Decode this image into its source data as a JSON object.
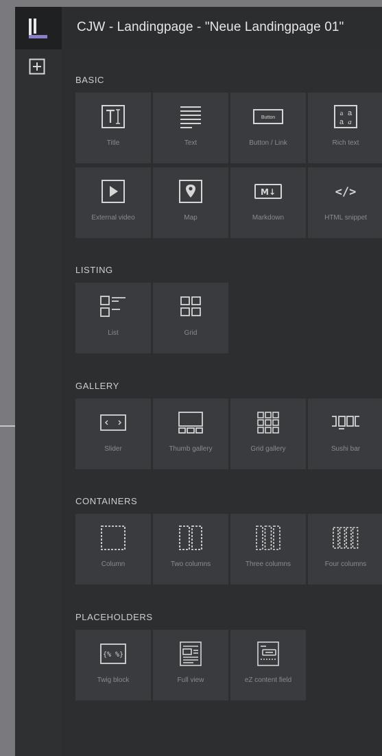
{
  "window": {
    "title": "CJW - Landingpage - \"Neue Landingpage 01\" "
  },
  "sidebar": {
    "add_icon": "plus-square-icon",
    "logo": "app-logo"
  },
  "sections": {
    "basic": {
      "label": "BASIC",
      "items": [
        {
          "label": "Title",
          "icon": "title-icon"
        },
        {
          "label": "Text",
          "icon": "text-icon"
        },
        {
          "label": "Button / Link",
          "icon": "button-icon"
        },
        {
          "label": "Rich text",
          "icon": "rich-text-icon"
        },
        {
          "label": "External video",
          "icon": "video-icon"
        },
        {
          "label": "Map",
          "icon": "map-icon"
        },
        {
          "label": "Markdown",
          "icon": "markdown-icon"
        },
        {
          "label": "HTML snippet",
          "icon": "code-icon"
        }
      ]
    },
    "listing": {
      "label": "LISTING",
      "items": [
        {
          "label": "List",
          "icon": "list-icon"
        },
        {
          "label": "Grid",
          "icon": "grid-icon"
        }
      ]
    },
    "gallery": {
      "label": "GALLERY",
      "items": [
        {
          "label": "Slider",
          "icon": "slider-icon"
        },
        {
          "label": "Thumb gallery",
          "icon": "thumb-gallery-icon"
        },
        {
          "label": "Grid gallery",
          "icon": "grid-gallery-icon"
        },
        {
          "label": "Sushi bar",
          "icon": "sushi-bar-icon"
        }
      ]
    },
    "containers": {
      "label": "CONTAINERS",
      "items": [
        {
          "label": "Column",
          "icon": "column-icon"
        },
        {
          "label": "Two columns",
          "icon": "two-columns-icon"
        },
        {
          "label": "Three columns",
          "icon": "three-columns-icon"
        },
        {
          "label": "Four columns",
          "icon": "four-columns-icon"
        }
      ]
    },
    "placeholders": {
      "label": "PLACEHOLDERS",
      "items": [
        {
          "label": "Twig block",
          "icon": "twig-block-icon"
        },
        {
          "label": "Full view",
          "icon": "full-view-icon"
        },
        {
          "label": "eZ content field",
          "icon": "content-field-icon"
        }
      ]
    }
  },
  "button_icon_text": "Button",
  "markdown_icon_text": "M↓",
  "code_icon_text": "</>",
  "twig_icon_text": "{% %}",
  "colors": {
    "background": "#2d2e30",
    "tile": "#3a3b3e",
    "label": "#8a8b8f",
    "heading": "#cfcfcf"
  }
}
